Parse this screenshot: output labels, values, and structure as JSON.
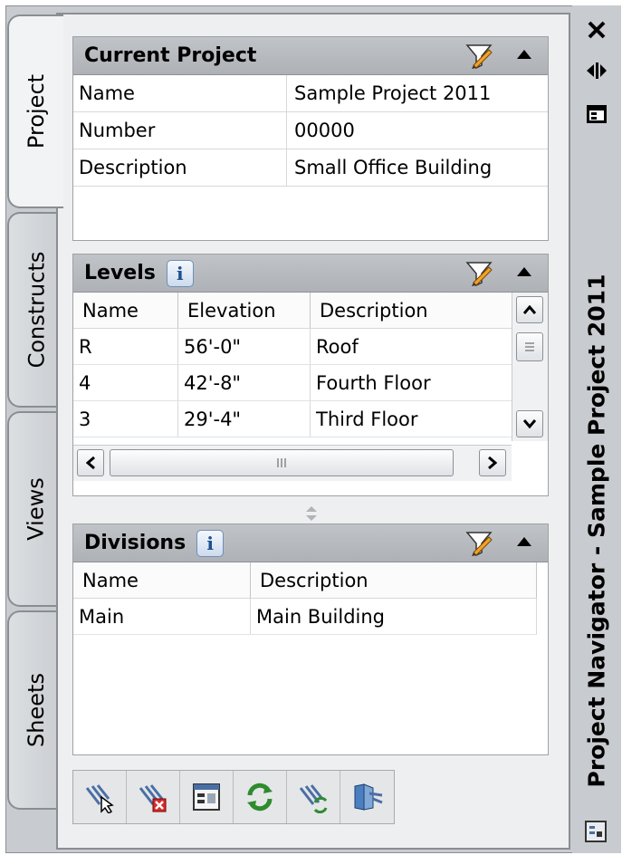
{
  "window": {
    "title": "Project Navigator - Sample Project 2011"
  },
  "tabs": [
    {
      "label": "Project",
      "active": true
    },
    {
      "label": "Constructs",
      "active": false
    },
    {
      "label": "Views",
      "active": false
    },
    {
      "label": "Sheets",
      "active": false
    }
  ],
  "current_project": {
    "title": "Current Project",
    "rows": [
      {
        "key": "Name",
        "value": "Sample Project 2011"
      },
      {
        "key": "Number",
        "value": "00000"
      },
      {
        "key": "Description",
        "value": "Small Office Building"
      }
    ]
  },
  "levels": {
    "title": "Levels",
    "info": "i",
    "columns": [
      "Name",
      "Elevation",
      "Description"
    ],
    "rows": [
      {
        "name": "R",
        "elevation": "56'-0\"",
        "description": "Roof"
      },
      {
        "name": "4",
        "elevation": "42'-8\"",
        "description": "Fourth Floor"
      },
      {
        "name": "3",
        "elevation": "29'-4\"",
        "description": "Third Floor"
      }
    ]
  },
  "divisions": {
    "title": "Divisions",
    "info": "i",
    "columns": [
      "Name",
      "Description"
    ],
    "rows": [
      {
        "name": "Main",
        "description": "Main Building"
      }
    ]
  },
  "toolbar": {
    "icons": [
      "select-project-icon",
      "close-project-icon",
      "project-browser-icon",
      "refresh-icon",
      "repath-project-icon",
      "open-folder-icon"
    ]
  },
  "colors": {
    "panel_bg": "#eeeff0",
    "header_bg": "#b6b9bd",
    "frame_bg": "#c8cbcf",
    "accent_blue": "#1d4f8f"
  }
}
